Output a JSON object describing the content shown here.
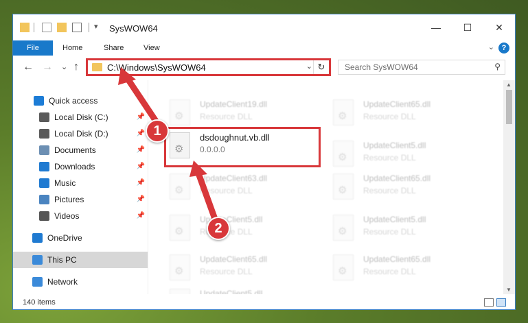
{
  "window": {
    "title": "SysWOW64"
  },
  "caption": {
    "minimize": "—",
    "maximize": "☐",
    "close": "✕"
  },
  "ribbon": {
    "tabs": [
      "File",
      "Home",
      "Share",
      "View"
    ],
    "help": "?",
    "expand": "⌄"
  },
  "navigation": {
    "back": "←",
    "forward": "→",
    "recent": "⌄",
    "up": "↑",
    "address": "C:\\Windows\\SysWOW64",
    "address_dropdown": "⌄",
    "refresh": "↻",
    "search_placeholder": "Search SysWOW64",
    "search_icon": "⚲"
  },
  "sidebar": {
    "items": [
      {
        "label": "Quick access",
        "icon": "star-icon",
        "color": "#1c7cd6",
        "pinned": false
      },
      {
        "label": "Local Disk (C:)",
        "icon": "drive-icon",
        "color": "#5a5a5a",
        "pinned": true
      },
      {
        "label": "Local Disk (D:)",
        "icon": "drive-icon",
        "color": "#5a5a5a",
        "pinned": true
      },
      {
        "label": "Documents",
        "icon": "documents-icon",
        "color": "#6c8fb3",
        "pinned": true
      },
      {
        "label": "Downloads",
        "icon": "downloads-icon",
        "color": "#1f7ad1",
        "pinned": true
      },
      {
        "label": "Music",
        "icon": "music-icon",
        "color": "#1f7ad1",
        "pinned": true
      },
      {
        "label": "Pictures",
        "icon": "pictures-icon",
        "color": "#4a84c0",
        "pinned": true
      },
      {
        "label": "Videos",
        "icon": "videos-icon",
        "color": "#555",
        "pinned": true
      },
      {
        "label": "OneDrive",
        "icon": "onedrive-icon",
        "color": "#1f7ad1",
        "pinned": false
      },
      {
        "label": "This PC",
        "icon": "computer-icon",
        "color": "#3b8ad9",
        "pinned": false
      },
      {
        "label": "Network",
        "icon": "network-icon",
        "color": "#3b8ad9",
        "pinned": false
      }
    ],
    "pin_glyph": "📌"
  },
  "files": {
    "highlighted": {
      "name": "dsdoughnut.vb.dll",
      "description": "0.0.0.0"
    },
    "background": [
      {
        "name": "UpdateClient19.dll",
        "description": "Resource DLL"
      },
      {
        "name": "UpdateClient65.dll",
        "description": "Resource DLL"
      },
      {
        "name": "UpdateClient5.dll",
        "description": "Resource DLL"
      },
      {
        "name": "UpdateClient63.dll",
        "description": "Resource DLL"
      },
      {
        "name": "UpdateClient65.dll",
        "description": "Resource DLL"
      },
      {
        "name": "UpdateClient5.dll",
        "description": "Resource DLL"
      },
      {
        "name": "UpdateClient5.dll",
        "description": "Resource DLL"
      },
      {
        "name": "UpdateClient65.dll",
        "description": "Resource DLL"
      },
      {
        "name": "UpdateClient65.dll",
        "description": "Resource DLL"
      },
      {
        "name": "UpdateClient5.dll",
        "description": "Resource DLL"
      }
    ]
  },
  "status": {
    "count": "140 items"
  },
  "annotations": {
    "step1": "1",
    "step2": "2",
    "accent": "#d8373a"
  }
}
